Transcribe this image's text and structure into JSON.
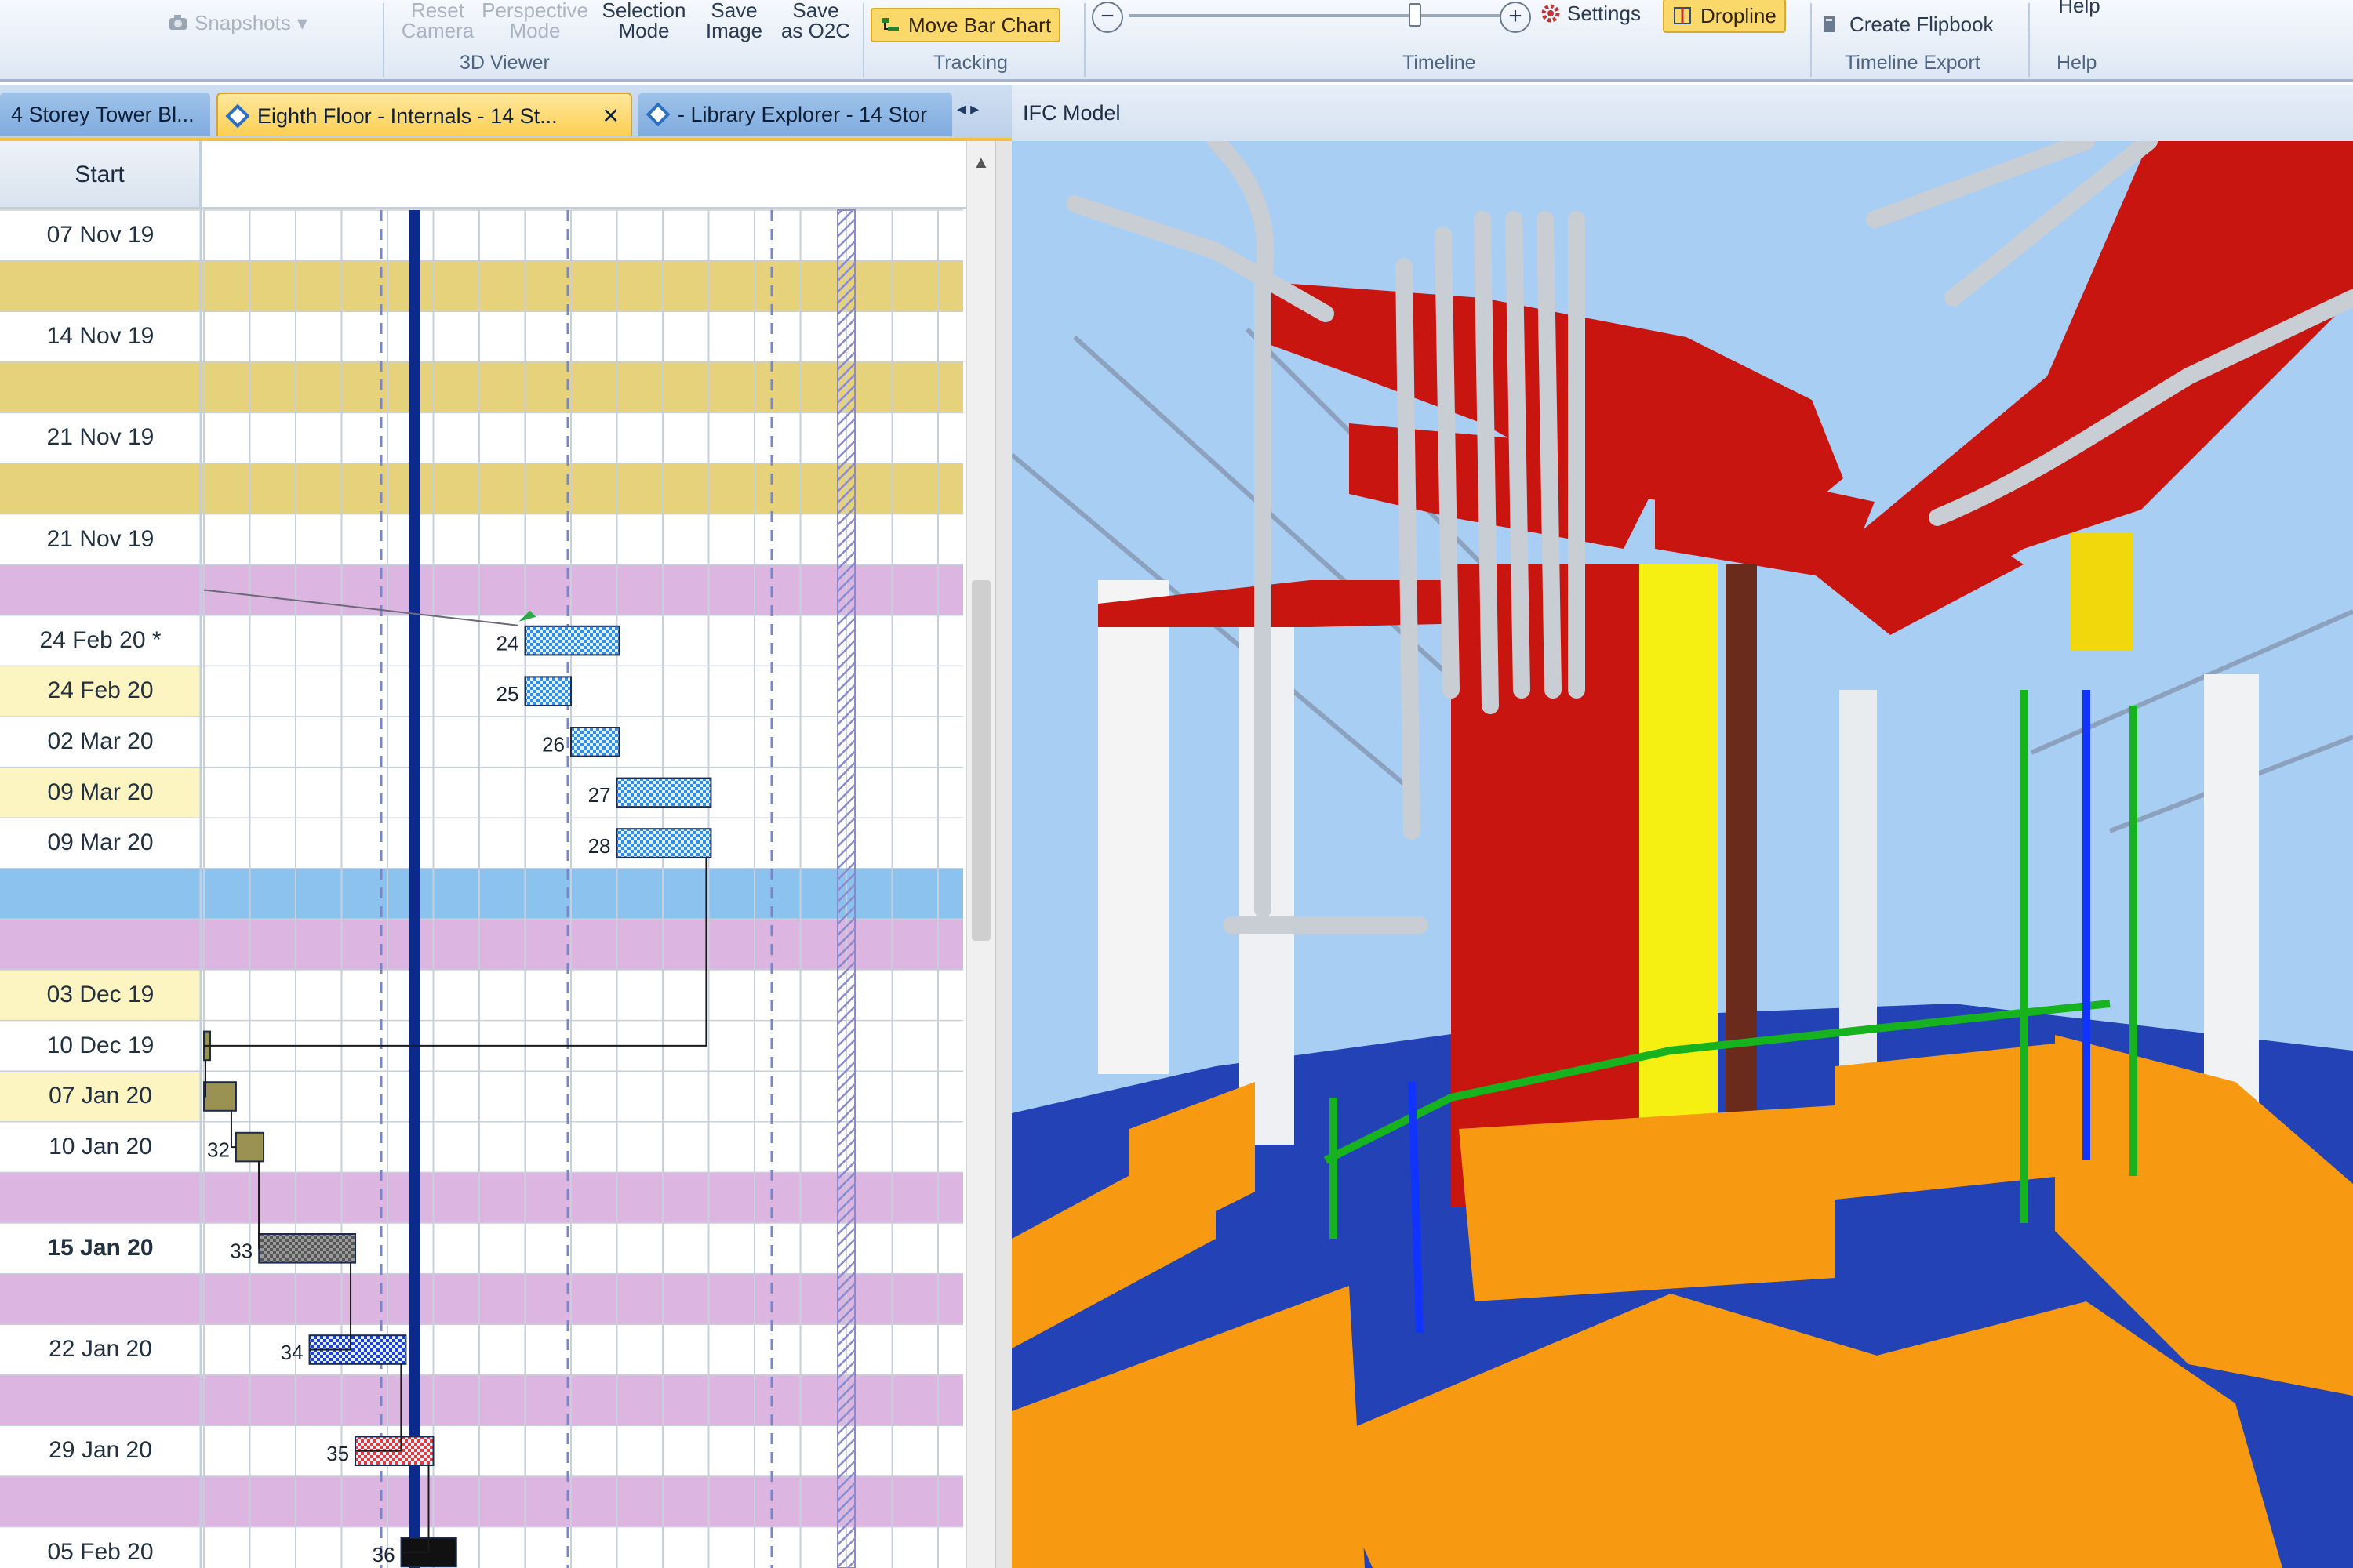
{
  "ribbon": {
    "snapshots": "Snapshots",
    "snapshots_arrow": "▾",
    "reset_camera": [
      "Reset",
      "Camera"
    ],
    "perspective_mode": [
      "Perspective",
      "Mode"
    ],
    "selection_mode": [
      "Selection",
      "Mode"
    ],
    "save_image": [
      "Save",
      "Image"
    ],
    "save_as_o2c": [
      "Save",
      "as O2C"
    ],
    "move_bar_chart": "Move Bar Chart",
    "settings": "Settings",
    "dropline": "Dropline",
    "create_flipbook": "Create Flipbook",
    "help": "Help",
    "groups": {
      "viewer": "3D Viewer",
      "tracking": "Tracking",
      "timeline": "Timeline",
      "timeline_export": "Timeline Export",
      "help": "Help"
    },
    "zoom_out": "−",
    "zoom_in": "+"
  },
  "tabs": [
    {
      "label": "4 Storey Tower Bl..."
    },
    {
      "label": "Eighth Floor - Internals - 14 St...",
      "close": "✕"
    },
    {
      "label": "- Library Explorer - 14 Stor"
    }
  ],
  "tab_scroll": "◂ ▸",
  "view_title": "IFC Model",
  "gantt": {
    "start_header": "Start",
    "rows": [
      {
        "date": "07 Nov 19",
        "bg": "#ffffff"
      },
      {
        "date": "",
        "bg": "#e6d27a"
      },
      {
        "date": "14 Nov 19",
        "bg": "#ffffff"
      },
      {
        "date": "",
        "bg": "#e6d27a"
      },
      {
        "date": "21 Nov 19",
        "bg": "#ffffff"
      },
      {
        "date": "",
        "bg": "#e6d27a"
      },
      {
        "date": "21 Nov 19",
        "bg": "#ffffff"
      },
      {
        "date": "",
        "bg": "#dcb6e0"
      },
      {
        "date": "24 Feb 20 *",
        "bg": "#ffffff"
      },
      {
        "date": "24 Feb 20",
        "bg": "#ffffff",
        "cellbg": "#fcf5c2"
      },
      {
        "date": "02 Mar 20",
        "bg": "#ffffff"
      },
      {
        "date": "09 Mar 20",
        "bg": "#ffffff",
        "cellbg": "#fcf5c2"
      },
      {
        "date": "09 Mar 20",
        "bg": "#ffffff"
      },
      {
        "date": "",
        "bg": "#8cc2ee"
      },
      {
        "date": "",
        "bg": "#dcb6e0"
      },
      {
        "date": "03 Dec 19",
        "bg": "#ffffff",
        "cellbg": "#fcf5c2"
      },
      {
        "date": "10 Dec 19",
        "bg": "#ffffff"
      },
      {
        "date": "07 Jan 20",
        "bg": "#ffffff",
        "cellbg": "#fcf5c2"
      },
      {
        "date": "10 Jan 20",
        "bg": "#ffffff"
      },
      {
        "date": "",
        "bg": "#dcb6e0"
      },
      {
        "date": "15 Jan 20",
        "bg": "#ffffff",
        "bold": true
      },
      {
        "date": "",
        "bg": "#dcb6e0"
      },
      {
        "date": "22 Jan 20",
        "bg": "#ffffff"
      },
      {
        "date": "",
        "bg": "#dcb6e0"
      },
      {
        "date": "29 Jan 20",
        "bg": "#ffffff"
      },
      {
        "date": "",
        "bg": "#dcb6e0"
      },
      {
        "date": "05 Feb 20",
        "bg": "#ffffff"
      }
    ],
    "bars": [
      {
        "id": "24",
        "row": 8,
        "start": 7,
        "len": 2.05,
        "kind": "milestone-blue"
      },
      {
        "id": "25",
        "row": 9,
        "start": 7,
        "len": 1.0,
        "kind": "blue"
      },
      {
        "id": "26",
        "row": 10,
        "start": 8,
        "len": 1.05,
        "kind": "blue"
      },
      {
        "id": "27",
        "row": 11,
        "start": 9,
        "len": 2.05,
        "kind": "blue"
      },
      {
        "id": "28",
        "row": 12,
        "start": 9,
        "len": 2.05,
        "kind": "blue"
      },
      {
        "id": "",
        "row": 16,
        "start": 0,
        "len": 0.08,
        "kind": "olive"
      },
      {
        "id": "",
        "row": 17,
        "start": 0,
        "len": 0.7,
        "kind": "olive"
      },
      {
        "id": "32",
        "row": 18,
        "start": 0.7,
        "len": 0.6,
        "kind": "olive"
      },
      {
        "id": "33",
        "row": 20,
        "start": 1.2,
        "len": 2.1,
        "kind": "grey"
      },
      {
        "id": "34",
        "row": 22,
        "start": 2.3,
        "len": 2.1,
        "kind": "darkblue"
      },
      {
        "id": "35",
        "row": 24,
        "start": 3.3,
        "len": 1.7,
        "kind": "red"
      },
      {
        "id": "36",
        "row": 26,
        "start": 4.3,
        "len": 1.2,
        "kind": "black"
      }
    ],
    "colors": {
      "grid": "#c8d0dc",
      "today_line": "#0b2a8c",
      "dashed_line": "#7a86c6",
      "hatch_line": "#8a8ad0",
      "bar_blue": "#2f8ee6",
      "bar_darkblue": "#1f3fd8",
      "bar_red": "#e03a3a",
      "bar_grey": "#555555",
      "bar_olive": "#9a9252",
      "bar_black": "#111111"
    }
  },
  "model": {
    "sky": "#a9cef3",
    "floor": "#2342b5",
    "duct_red": "#c9150f",
    "orange": "#f79a12",
    "yellow": "#f6ef12",
    "pipe_grey": "#c9cdd4",
    "green": "#17b31e",
    "blue_pipe": "#1133ff",
    "brown": "#6a2a1c"
  }
}
